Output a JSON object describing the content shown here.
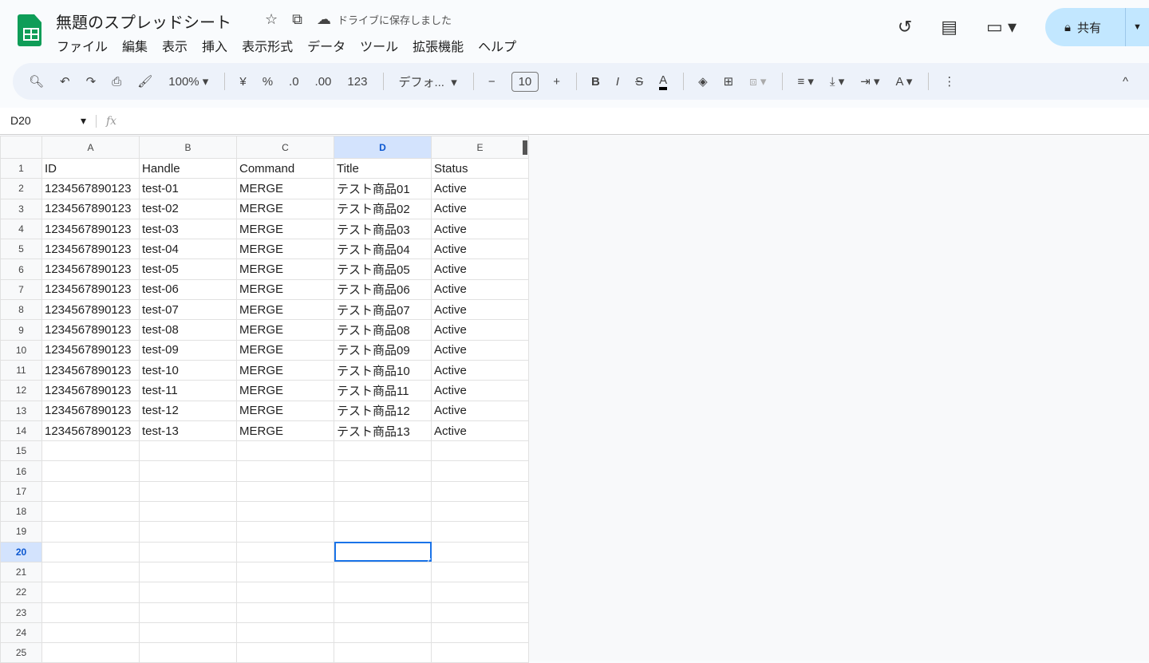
{
  "app": {
    "title": "無題のスプレッドシート",
    "save_status": "ドライブに保存しました",
    "share_label": "共有"
  },
  "menu": [
    "ファイル",
    "編集",
    "表示",
    "挿入",
    "表示形式",
    "データ",
    "ツール",
    "拡張機能",
    "ヘルプ"
  ],
  "toolbar": {
    "zoom": "100%",
    "currency": "¥",
    "percent": "%",
    "dec_decrease": ".0",
    "dec_increase": ".00",
    "number_format": "123",
    "font": "デフォ...",
    "font_size": "10"
  },
  "formula_bar": {
    "name_box": "D20",
    "fx": "fx",
    "value": ""
  },
  "grid": {
    "columns": [
      "A",
      "B",
      "C",
      "D",
      "E"
    ],
    "selected_col": "D",
    "selected_row": 20,
    "total_rows": 25,
    "rows": [
      [
        "ID",
        "Handle",
        "Command",
        "Title",
        "Status"
      ],
      [
        "1234567890123",
        "test-01",
        "MERGE",
        "テスト商品01",
        "Active"
      ],
      [
        "1234567890123",
        "test-02",
        "MERGE",
        "テスト商品02",
        "Active"
      ],
      [
        "1234567890123",
        "test-03",
        "MERGE",
        "テスト商品03",
        "Active"
      ],
      [
        "1234567890123",
        "test-04",
        "MERGE",
        "テスト商品04",
        "Active"
      ],
      [
        "1234567890123",
        "test-05",
        "MERGE",
        "テスト商品05",
        "Active"
      ],
      [
        "1234567890123",
        "test-06",
        "MERGE",
        "テスト商品06",
        "Active"
      ],
      [
        "1234567890123",
        "test-07",
        "MERGE",
        "テスト商品07",
        "Active"
      ],
      [
        "1234567890123",
        "test-08",
        "MERGE",
        "テスト商品08",
        "Active"
      ],
      [
        "1234567890123",
        "test-09",
        "MERGE",
        "テスト商品09",
        "Active"
      ],
      [
        "1234567890123",
        "test-10",
        "MERGE",
        "テスト商品10",
        "Active"
      ],
      [
        "1234567890123",
        "test-11",
        "MERGE",
        "テスト商品11",
        "Active"
      ],
      [
        "1234567890123",
        "test-12",
        "MERGE",
        "テスト商品12",
        "Active"
      ],
      [
        "1234567890123",
        "test-13",
        "MERGE",
        "テスト商品13",
        "Active"
      ]
    ]
  }
}
